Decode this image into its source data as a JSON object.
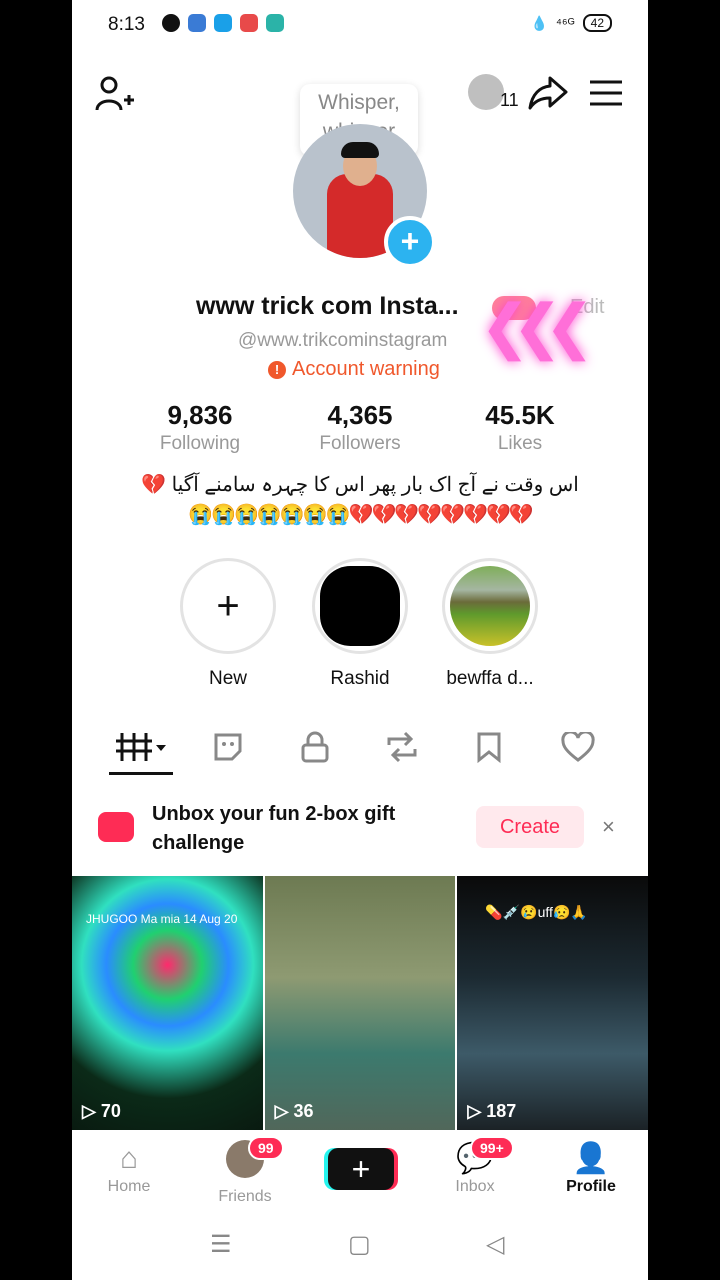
{
  "status_bar": {
    "time": "8:13",
    "signal": "⁴⁶ᴳ",
    "battery": "42"
  },
  "tooltip": {
    "text": "Whisper, whisper"
  },
  "header": {
    "friends_count": "11"
  },
  "profile": {
    "display_name": "www trick com Insta...",
    "edit_label": "Edit",
    "username": "@www.trikcominstagram",
    "warning": "Account warning"
  },
  "stats": [
    {
      "value": "9,836",
      "label": "Following"
    },
    {
      "value": "4,365",
      "label": "Followers"
    },
    {
      "value": "45.5K",
      "label": "Likes"
    }
  ],
  "bio": {
    "line1": "اس وقت  نے آج اک بار پھر اس کا چہرہ سامنے آگیا 💔",
    "line2": "😭😭😭😭😭😭😭💔💔💔💔💔💔💔💔"
  },
  "highlights": [
    {
      "label": "New",
      "glyph": "+"
    },
    {
      "label": "Rashid"
    },
    {
      "label": "bewffa d..."
    }
  ],
  "tabs": [
    "videos-tab",
    "stickers-tab",
    "private-tab",
    "reposts-tab",
    "saved-tab",
    "liked-tab"
  ],
  "promo": {
    "text": "Unbox your fun 2-box gift challenge",
    "button": "Create",
    "close": "×"
  },
  "videos": [
    {
      "views": "70",
      "caption": "JHUGOO Ma mia 14 Aug 20"
    },
    {
      "views": "36",
      "caption": ""
    },
    {
      "views": "187",
      "caption": "💊💉😢uff😥🙏"
    }
  ],
  "bottom_nav": {
    "home": "Home",
    "friends": "Friends",
    "friends_badge": "99",
    "inbox": "Inbox",
    "inbox_badge": "99+",
    "profile": "Profile"
  },
  "colors": {
    "accent": "#fe2c55",
    "cyan": "#25f4ee",
    "warning": "#f0582c"
  }
}
